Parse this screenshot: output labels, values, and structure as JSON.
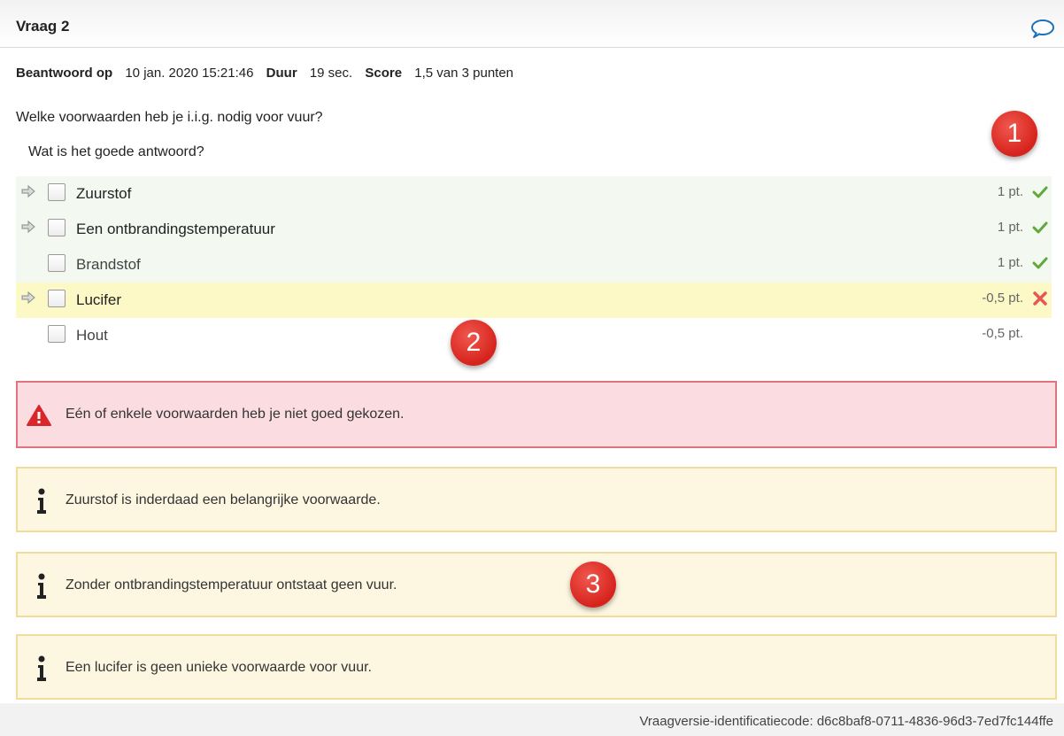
{
  "header": {
    "title": "Vraag 2",
    "comment_icon": "speech-bubble-icon"
  },
  "meta": {
    "answered_label": "Beantwoord op",
    "answered_value": "10 jan. 2020 15:21:46",
    "duration_label": "Duur",
    "duration_value": "19 sec.",
    "score_label": "Score",
    "score_value": "1,5 van 3 punten"
  },
  "question": "Welke voorwaarden heb je i.i.g. nodig voor vuur?",
  "subquestion": "Wat is het goede antwoord?",
  "options": [
    {
      "label": "Zuurstof",
      "points": "1 pt.",
      "selected": true,
      "status": "correct"
    },
    {
      "label": "Een ontbrandingstemperatuur",
      "points": "1 pt.",
      "selected": true,
      "status": "correct"
    },
    {
      "label": "Brandstof",
      "points": "1 pt.",
      "selected": false,
      "status": "correct"
    },
    {
      "label": "Lucifer",
      "points": "-0,5 pt.",
      "selected": true,
      "status": "wrong"
    },
    {
      "label": "Hout",
      "points": "-0,5 pt.",
      "selected": false,
      "status": "none"
    }
  ],
  "badges": [
    "1",
    "2",
    "3"
  ],
  "feedback": {
    "error": "Eén of enkele voorwaarden heb je niet goed gekozen.",
    "info": [
      "Zuurstof is inderdaad een belangrijke voorwaarde.",
      "Zonder ontbrandingstemperatuur ontstaat geen vuur.",
      "Een lucifer is geen unieke voorwaarde voor vuur."
    ]
  },
  "footer": {
    "version_code": "Vraagversie-identificatiecode: d6c8baf8-0711-4836-96d3-7ed7fc144ffe"
  },
  "colors": {
    "correct_bg": "#f3f8f1",
    "wrong_bg": "#fdf9c6",
    "error_bg": "#fbdde1",
    "info_bg": "#fdf6e1",
    "badge": "#d6231c"
  }
}
